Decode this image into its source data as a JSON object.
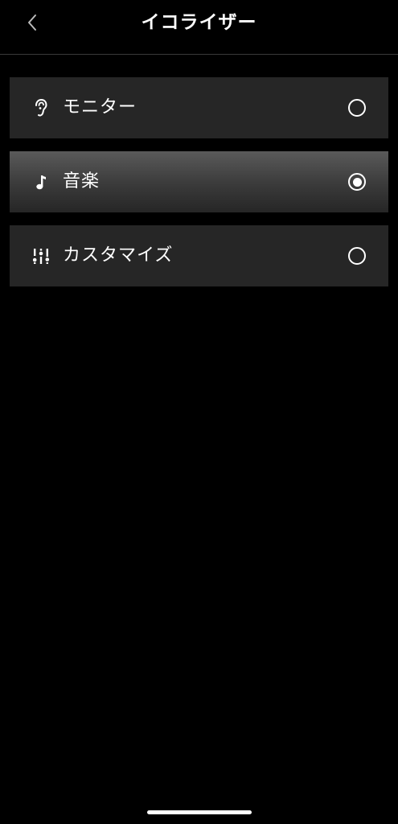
{
  "header": {
    "title": "イコライザー",
    "back_icon": "chevron-left-icon"
  },
  "equalizer": {
    "options": [
      {
        "label": "モニター",
        "icon": "ear-icon",
        "selected": false
      },
      {
        "label": "音楽",
        "icon": "music-note-icon",
        "selected": true
      },
      {
        "label": "カスタマイズ",
        "icon": "sliders-icon",
        "selected": false
      }
    ]
  },
  "colors": {
    "background": "#000000",
    "item_background": "#262626",
    "selected_highlight": "#5a5a5a",
    "text": "#ffffff",
    "divider": "#3a3a3a"
  }
}
